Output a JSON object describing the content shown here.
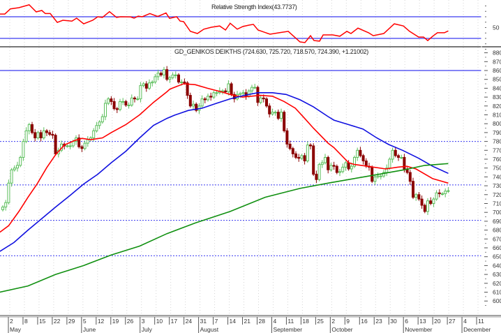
{
  "chart_data": [
    {
      "type": "line",
      "panel": "rsi",
      "title": "Relative Strength Index(43.7737)",
      "y_tick_labels": [
        "50"
      ],
      "reference_lines": [
        70,
        30
      ],
      "colors": {
        "line": "#ff0000",
        "ref": "#3a3af0"
      },
      "points": [
        [
          -1,
          75
        ],
        [
          0.7,
          75
        ],
        [
          2.6,
          84.6
        ],
        [
          5.5,
          86.8
        ],
        [
          9,
          92
        ],
        [
          11.4,
          79
        ],
        [
          13.3,
          81.6
        ],
        [
          14.5,
          76
        ],
        [
          16.2,
          76
        ],
        [
          18.6,
          59.6
        ],
        [
          20.5,
          63.5
        ],
        [
          23.6,
          62
        ],
        [
          25.2,
          67.4
        ],
        [
          27.6,
          57
        ],
        [
          30.7,
          63.5
        ],
        [
          32.4,
          70
        ],
        [
          34,
          68.7
        ],
        [
          36.4,
          79.4
        ],
        [
          38.8,
          68.7
        ],
        [
          40.2,
          70
        ],
        [
          43.6,
          69.6
        ],
        [
          44.8,
          67.4
        ],
        [
          46.2,
          71
        ],
        [
          47.6,
          70
        ],
        [
          50.2,
          76
        ],
        [
          52.6,
          71
        ],
        [
          53.1,
          71
        ],
        [
          55.7,
          77
        ],
        [
          56.9,
          67
        ],
        [
          59.3,
          70
        ],
        [
          60.5,
          62
        ],
        [
          61.7,
          61
        ],
        [
          64,
          43
        ],
        [
          66.4,
          39
        ],
        [
          68.6,
          47
        ],
        [
          71.2,
          50.6
        ],
        [
          74,
          53
        ],
        [
          76,
          45.5
        ],
        [
          77.6,
          58
        ],
        [
          80,
          47
        ],
        [
          81.9,
          52
        ],
        [
          84,
          54.5
        ],
        [
          85.5,
          56
        ],
        [
          87.1,
          45.5
        ],
        [
          91.2,
          37.7
        ],
        [
          94.3,
          40.5
        ],
        [
          97.4,
          43
        ],
        [
          101.4,
          23.5
        ],
        [
          103.1,
          22.3
        ],
        [
          105,
          35
        ],
        [
          106.2,
          26
        ],
        [
          108.1,
          25
        ],
        [
          109.3,
          36.5
        ],
        [
          112.6,
          36.5
        ],
        [
          115,
          34
        ],
        [
          117.4,
          43
        ],
        [
          118.8,
          39
        ],
        [
          121.2,
          49
        ],
        [
          124.8,
          40.5
        ],
        [
          126.4,
          35
        ],
        [
          130,
          39
        ],
        [
          133.6,
          57
        ],
        [
          136.7,
          53
        ],
        [
          138.8,
          43
        ],
        [
          141.9,
          32.5
        ],
        [
          143.6,
          32.5
        ],
        [
          145,
          26
        ],
        [
          146.7,
          34
        ],
        [
          148.3,
          40.5
        ],
        [
          150.7,
          40.5
        ],
        [
          152,
          43.77
        ]
      ]
    },
    {
      "type": "candlestick",
      "panel": "price",
      "title": "GD_GENIKOS DEIKTHS (724.630, 725.720, 718.570, 724.390, +1.21002)",
      "last_ohlc": {
        "open": 724.63,
        "high": 725.72,
        "low": 718.57,
        "close": 724.39,
        "change": 1.21002
      },
      "ylim": [
        595,
        885
      ],
      "y_tick_labels": [
        "880",
        "870",
        "860",
        "850",
        "840",
        "830",
        "820",
        "810",
        "800",
        "790",
        "780",
        "770",
        "760",
        "750",
        "740",
        "730",
        "720",
        "710",
        "700",
        "690",
        "680",
        "670",
        "660",
        "650",
        "640",
        "630",
        "620",
        "610",
        "600"
      ],
      "x_tick_labels": [
        "2",
        "8",
        "15",
        "22",
        "29",
        "5",
        "12",
        "19",
        "26",
        "3",
        "10",
        "17",
        "24",
        "31",
        "7",
        "14",
        "21",
        "28",
        "4",
        "11",
        "18",
        "25",
        "2",
        "9",
        "16",
        "23",
        "30",
        "6",
        "13",
        "20",
        "27",
        "4",
        "11"
      ],
      "month_labels": [
        {
          "label": "May",
          "tick": 0
        },
        {
          "label": "June",
          "tick": 5
        },
        {
          "label": "July",
          "tick": 9
        },
        {
          "label": "August",
          "tick": 13
        },
        {
          "label": "September",
          "tick": 18
        },
        {
          "label": "October",
          "tick": 22
        },
        {
          "label": "November",
          "tick": 27
        },
        {
          "label": "December",
          "tick": 31
        }
      ],
      "reference_lines": {
        "solid": [
          860
        ],
        "dotted": [
          780,
          731,
          691,
          651
        ]
      },
      "colors": {
        "up": "#5cbf5c",
        "down": "#8b0000",
        "ref": "#3a3af0"
      },
      "close": [
        706,
        711,
        733,
        748,
        750,
        753,
        762,
        780,
        792,
        799,
        790,
        784,
        790,
        784,
        792,
        790,
        788,
        787,
        766,
        770,
        777,
        775,
        775,
        775,
        780,
        784,
        774,
        772,
        778,
        782,
        784,
        792,
        798,
        802,
        808,
        823,
        828,
        825,
        817,
        816,
        825,
        825,
        821,
        821,
        829,
        828,
        828,
        843,
        845,
        840,
        846,
        847,
        853,
        857,
        855,
        861,
        850,
        852,
        855,
        855,
        847,
        847,
        846,
        832,
        820,
        822,
        815,
        820,
        828,
        827,
        831,
        830,
        835,
        835,
        837,
        837,
        836,
        845,
        833,
        828,
        833,
        834,
        835,
        831,
        837,
        841,
        841,
        824,
        829,
        828,
        820,
        811,
        813,
        813,
        806,
        813,
        792,
        777,
        772,
        766,
        762,
        761,
        764,
        758,
        776,
        775,
        743,
        737,
        754,
        756,
        762,
        748,
        753,
        752,
        745,
        746,
        751,
        756,
        749,
        752,
        762,
        770,
        764,
        758,
        752,
        751,
        735,
        740,
        741,
        741,
        745,
        750,
        760,
        770,
        764,
        762,
        762,
        749,
        745,
        735,
        717,
        720,
        715,
        708,
        701,
        713,
        710,
        715,
        722,
        721,
        721,
        724,
        724.39
      ],
      "moving_averages": [
        {
          "name": "short MA",
          "color": "#ff0000",
          "points": [
            [
              -1,
              677.6
            ],
            [
              2,
              685
            ],
            [
              5.5,
              701
            ],
            [
              8.6,
              717
            ],
            [
              11.7,
              732
            ],
            [
              15,
              750.5
            ],
            [
              18,
              765
            ],
            [
              21,
              776
            ],
            [
              24.5,
              781
            ],
            [
              27,
              783.5
            ],
            [
              30,
              782
            ],
            [
              34,
              784
            ],
            [
              37,
              790
            ],
            [
              42,
              799
            ],
            [
              46.7,
              810
            ],
            [
              51.4,
              824
            ],
            [
              56,
              836
            ],
            [
              57,
              839
            ],
            [
              61.7,
              845
            ],
            [
              65.7,
              844
            ],
            [
              69.8,
              840
            ],
            [
              74.5,
              836
            ],
            [
              77.6,
              833
            ],
            [
              81.7,
              830
            ],
            [
              84.8,
              831
            ],
            [
              87.9,
              832
            ],
            [
              92,
              831
            ],
            [
              96,
              825
            ],
            [
              99.8,
              817.5
            ],
            [
              103,
              806
            ],
            [
              106,
              795
            ],
            [
              111,
              778
            ],
            [
              113,
              773
            ],
            [
              118,
              756
            ],
            [
              120,
              754
            ],
            [
              124.5,
              752
            ],
            [
              130.7,
              749
            ],
            [
              134.8,
              751
            ],
            [
              137.9,
              752
            ],
            [
              141,
              749
            ],
            [
              146.7,
              738
            ],
            [
              152,
              733
            ]
          ]
        },
        {
          "name": "medium MA",
          "color": "#1010e0",
          "points": [
            [
              -1,
              656
            ],
            [
              3.8,
              666
            ],
            [
              8.6,
              680
            ],
            [
              13.3,
              693
            ],
            [
              18,
              706
            ],
            [
              22.9,
              719
            ],
            [
              27.6,
              732
            ],
            [
              32.4,
              743
            ],
            [
              37,
              756
            ],
            [
              42,
              769
            ],
            [
              46.7,
              784
            ],
            [
              51.4,
              798
            ],
            [
              56,
              806
            ],
            [
              58.6,
              809.6
            ],
            [
              63.3,
              815
            ],
            [
              68,
              817.5
            ],
            [
              72.9,
              823
            ],
            [
              77.6,
              828
            ],
            [
              82.4,
              832
            ],
            [
              87,
              835
            ],
            [
              92,
              835
            ],
            [
              96.7,
              833
            ],
            [
              101.4,
              827
            ],
            [
              106,
              819
            ],
            [
              111,
              808
            ],
            [
              113,
              804
            ],
            [
              118,
              799
            ],
            [
              122.9,
              794
            ],
            [
              127.6,
              784
            ],
            [
              131.7,
              776.5
            ],
            [
              136.4,
              770
            ],
            [
              141.9,
              761
            ],
            [
              146.7,
              752
            ],
            [
              152,
              744
            ]
          ]
        },
        {
          "name": "long MA",
          "color": "#109010",
          "points": [
            [
              -1,
              610
            ],
            [
              8.6,
              617
            ],
            [
              18,
              630
            ],
            [
              27.6,
              640
            ],
            [
              37,
              652
            ],
            [
              46.7,
              662
            ],
            [
              56,
              676
            ],
            [
              65.7,
              688
            ],
            [
              77.6,
              701
            ],
            [
              89.5,
              717
            ],
            [
              101.4,
              727
            ],
            [
              111,
              733
            ],
            [
              118,
              737
            ],
            [
              127.6,
              742.5
            ],
            [
              137,
              748
            ],
            [
              144,
              753
            ],
            [
              152,
              755
            ]
          ]
        }
      ]
    }
  ]
}
